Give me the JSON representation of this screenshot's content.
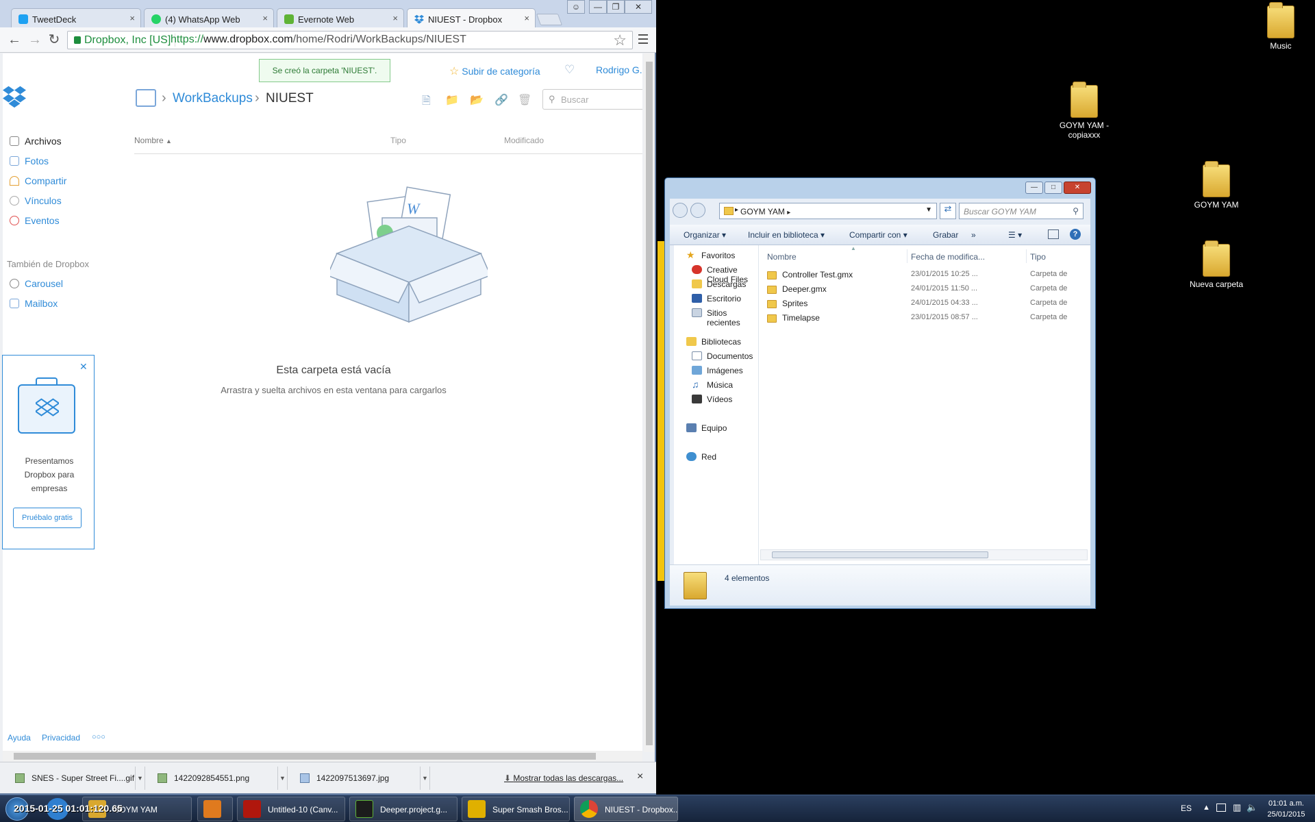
{
  "browser": {
    "tabs": [
      {
        "label": "TweetDeck",
        "color": "#1da1f2"
      },
      {
        "label": "(4) WhatsApp Web",
        "color": "#25d366"
      },
      {
        "label": "Evernote Web",
        "color": "#5fb336"
      },
      {
        "label": "NIUEST - Dropbox",
        "color": "#2f8bd8"
      }
    ],
    "tab_close": "×",
    "url_secure": "Dropbox, Inc [US]",
    "url_scheme": "https://",
    "url_host": "www.dropbox.com",
    "url_path": "/home/Rodri/WorkBackups/NIUEST"
  },
  "dropbox": {
    "toast": "Se creó la carpeta 'NIUEST'.",
    "upgrade": "Subir de categoría",
    "user": "Rodrigo G.",
    "breadcrumb_parent": "WorkBackups",
    "breadcrumb_current": "NIUEST",
    "search_placeholder": "Buscar",
    "sidebar": [
      "Archivos",
      "Fotos",
      "Compartir",
      "Vínculos",
      "Eventos"
    ],
    "also_heading": "También de Dropbox",
    "also_items": [
      "Carousel",
      "Mailbox"
    ],
    "columns": {
      "name": "Nombre",
      "type": "Tipo",
      "modified": "Modificado"
    },
    "empty_title": "Esta carpeta está vacía",
    "empty_sub": "Arrastra y suelta archivos en esta ventana para cargarlos",
    "promo_text": "Presentamos Dropbox para empresas",
    "promo_button": "Pruébalo gratis",
    "footer": {
      "help": "Ayuda",
      "privacy": "Privacidad",
      "more": "○○○"
    }
  },
  "downloads": {
    "items": [
      "SNES - Super Street Fi....gif",
      "1422092854551.png",
      "1422097513697.jpg"
    ],
    "show_all": "Mostrar todas las descargas...",
    "close": "×"
  },
  "explorer": {
    "path": "GOYM YAM",
    "search_placeholder": "Buscar GOYM YAM",
    "commands": [
      "Organizar ▾",
      "Incluir en biblioteca ▾",
      "Compartir con ▾",
      "Grabar",
      "»"
    ],
    "nav": {
      "favorites": "Favoritos",
      "fav_items": [
        "Creative Cloud Files",
        "Descargas",
        "Escritorio",
        "Sitios recientes"
      ],
      "libraries": "Bibliotecas",
      "lib_items": [
        "Documentos",
        "Imágenes",
        "Música",
        "Vídeos"
      ],
      "computer": "Equipo",
      "network": "Red"
    },
    "columns": {
      "name": "Nombre",
      "date": "Fecha de modifica...",
      "type": "Tipo"
    },
    "files": [
      {
        "name": "Controller Test.gmx",
        "date": "23/01/2015 10:25 ...",
        "type": "Carpeta de"
      },
      {
        "name": "Deeper.gmx",
        "date": "24/01/2015 11:50 ...",
        "type": "Carpeta de"
      },
      {
        "name": "Sprites",
        "date": "24/01/2015 04:33 ...",
        "type": "Carpeta de"
      },
      {
        "name": "Timelapse",
        "date": "23/01/2015 08:57 ...",
        "type": "Carpeta de"
      }
    ],
    "status": "4 elementos"
  },
  "desktop": {
    "icons": [
      "Music",
      "GOYM YAM - copiaxxx",
      "GOYM YAM",
      "Nueva carpeta"
    ]
  },
  "taskbar": {
    "overlay": "2015-01-25 01:01:120.65",
    "items": [
      {
        "label": "GOYM YAM",
        "color": "#d9a82f"
      },
      {
        "label": "Untitled-10 (Canv...",
        "color": "#b0170d"
      },
      {
        "label": "Deeper.project.g...",
        "color": "#5fb336"
      },
      {
        "label": "Super Smash Bros...",
        "color": "#e0b000"
      },
      {
        "label": "NIUEST - Dropbox...",
        "color": "#2f8bd8"
      }
    ],
    "lang": "ES",
    "time": "01:01 a.m.",
    "date": "25/01/2015"
  }
}
